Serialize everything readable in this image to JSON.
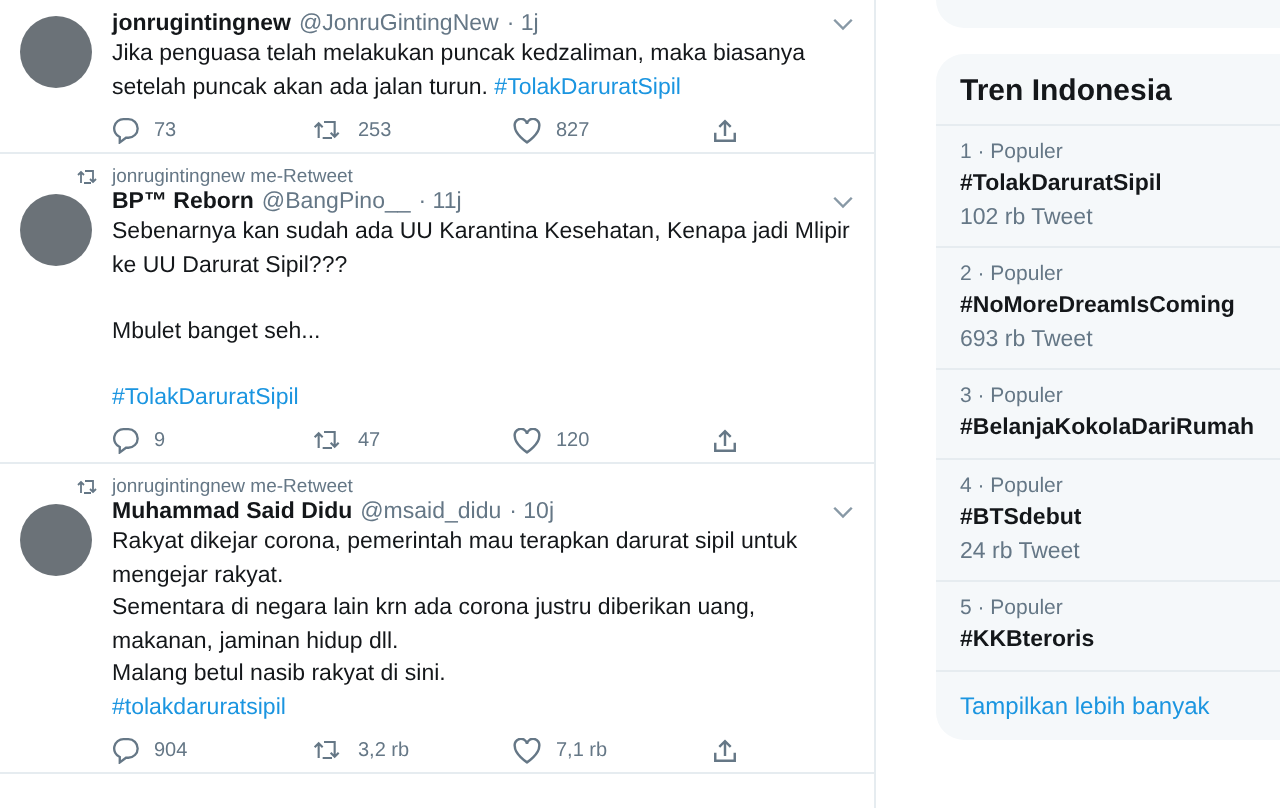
{
  "tweets": [
    {
      "name": "jonrugintingnew",
      "handle": "@JonruGintingNew",
      "time": "· 1j",
      "body": [
        {
          "kind": "text",
          "text": "Jika penguasa telah melakukan puncak kedzaliman, maka biasanya setelah puncak akan ada jalan turun. "
        },
        {
          "kind": "hashtag",
          "text": "#TolakDaruratSipil"
        }
      ],
      "replies": "73",
      "retweets": "253",
      "likes": "827"
    },
    {
      "retweeted_by": "jonrugintingnew me-Retweet",
      "name": "BP™ Reborn",
      "handle": "@BangPino__",
      "time": "· 11j",
      "body": [
        {
          "kind": "text",
          "text": "Sebenarnya kan sudah ada UU Karantina Kesehatan, Kenapa jadi Mlipir ke UU Darurat Sipil???\n\nMbulet banget seh...\n\n"
        },
        {
          "kind": "hashtag",
          "text": "#TolakDaruratSipil"
        }
      ],
      "replies": "9",
      "retweets": "47",
      "likes": "120"
    },
    {
      "retweeted_by": "jonrugintingnew me-Retweet",
      "name": "Muhammad Said Didu",
      "handle": "@msaid_didu",
      "time": "· 10j",
      "body": [
        {
          "kind": "text",
          "text": "Rakyat dikejar corona, pemerintah mau terapkan darurat sipil untuk mengejar rakyat.\nSementara di negara lain krn ada corona justru diberikan uang, makanan, jaminan hidup dll.\nMalang betul nasib rakyat di sini.\n"
        },
        {
          "kind": "hashtag",
          "text": "#tolakdaruratsipil"
        }
      ],
      "replies": "904",
      "retweets": "3,2 rb",
      "likes": "7,1 rb"
    }
  ],
  "trends": {
    "title": "Tren Indonesia",
    "items": [
      {
        "context": "1 · Populer",
        "hashtag": "#TolakDaruratSipil",
        "count": "102 rb Tweet"
      },
      {
        "context": "2 · Populer",
        "hashtag": "#NoMoreDreamIsComing",
        "count": "693 rb Tweet"
      },
      {
        "context": "3 · Populer",
        "hashtag": "#BelanjaKokolaDariRumah"
      },
      {
        "context": "4 · Populer",
        "hashtag": "#BTSdebut",
        "count": "24 rb Tweet"
      },
      {
        "context": "5 · Populer",
        "hashtag": "#KKBteroris"
      }
    ],
    "show_more": "Tampilkan lebih banyak"
  }
}
